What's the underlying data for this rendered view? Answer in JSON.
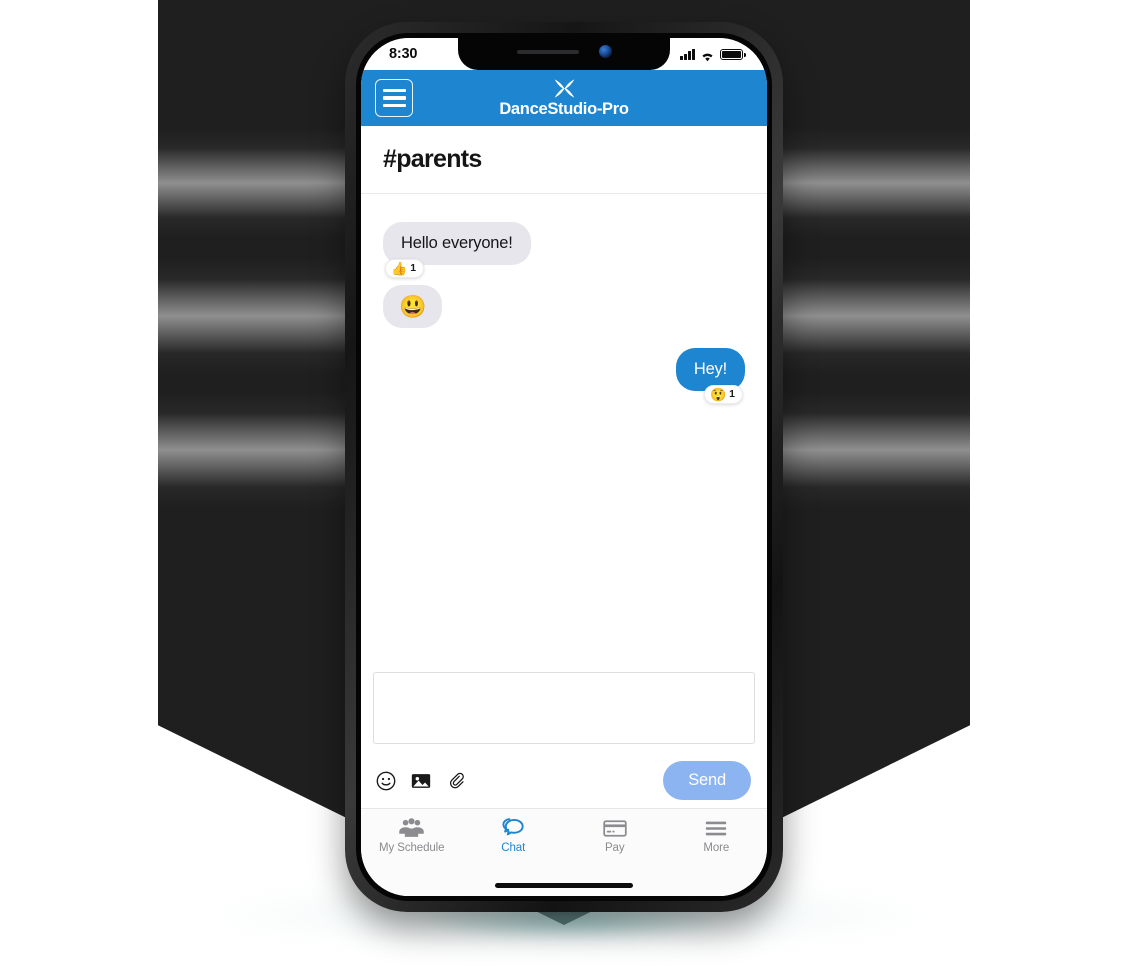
{
  "status_bar": {
    "time": "8:30",
    "icons": [
      "signal-bars-icon",
      "wifi-icon",
      "battery-icon"
    ]
  },
  "app_header": {
    "menu_icon": "hamburger-menu-icon",
    "logo_icon": "dancestudio-x-logo-icon",
    "brand_name": "DanceStudio-Pro",
    "background_color": "#1e86d0"
  },
  "channel": {
    "title": "#parents"
  },
  "messages": [
    {
      "id": "msg-1",
      "direction": "incoming",
      "text": "Hello everyone!",
      "emoji_only": false,
      "reaction": {
        "emoji": "👍",
        "emoji_name": "thumbs-up-emoji",
        "count": "1"
      }
    },
    {
      "id": "msg-2",
      "direction": "incoming",
      "text": "😃",
      "emoji_only": true,
      "reaction": null
    },
    {
      "id": "msg-3",
      "direction": "outgoing",
      "text": "Hey!",
      "emoji_only": false,
      "reaction": {
        "emoji": "😲",
        "emoji_name": "surprised-face-emoji",
        "count": "1"
      }
    }
  ],
  "composer": {
    "value": "",
    "placeholder": "",
    "tools": [
      {
        "name": "emoji-picker-icon",
        "label": "Emoji"
      },
      {
        "name": "image-attach-icon",
        "label": "Image"
      },
      {
        "name": "file-attach-icon",
        "label": "Attachment"
      }
    ],
    "send_label": "Send",
    "send_color": "#8cb4f0"
  },
  "bottom_nav": {
    "items": [
      {
        "label": "My Schedule",
        "icon": "people-group-icon",
        "active": false
      },
      {
        "label": "Chat",
        "icon": "chat-bubbles-icon",
        "active": true
      },
      {
        "label": "Pay",
        "icon": "credit-card-icon",
        "active": false
      },
      {
        "label": "More",
        "icon": "hamburger-more-icon",
        "active": false
      }
    ],
    "active_color": "#1e86d0",
    "inactive_color": "#8b8b90"
  },
  "theme": {
    "accent": "#1e86d0",
    "incoming_bubble": "#e6e6ec",
    "outgoing_bubble": "#1e86d0",
    "backdrop": "#201f1f"
  }
}
